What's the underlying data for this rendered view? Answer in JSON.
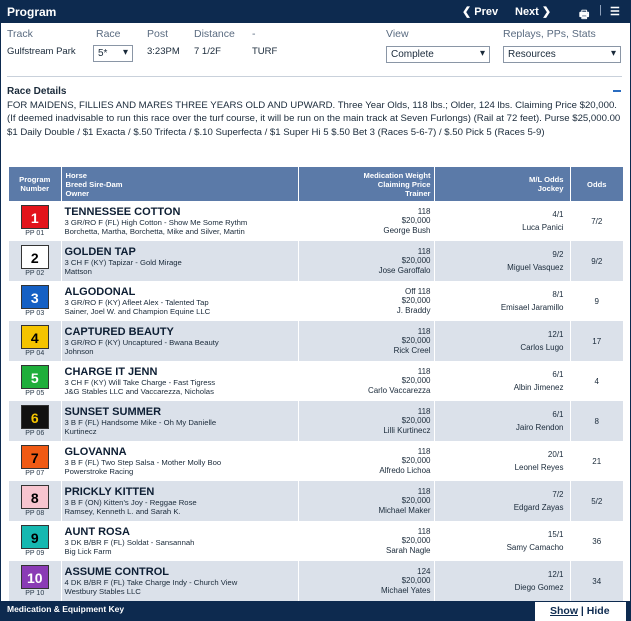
{
  "header": {
    "title": "Program",
    "prev_label": "❮ Prev",
    "next_label": "Next ❯",
    "print_glyph": "🖶",
    "separator": "|",
    "menu_glyph": "☰"
  },
  "fields": {
    "track_label": "Track",
    "track_value": "Gulfstream Park",
    "race_label": "Race",
    "race_value": "5*",
    "post_label": "Post",
    "post_value": "3:23PM",
    "distance_label": "Distance",
    "distance_value": "7 1/2F",
    "dash_label": "-",
    "surface_value": "TURF",
    "view_label": "View",
    "view_value": "Complete",
    "replays_label": "Replays, PPs, Stats",
    "replays_value": "Resources"
  },
  "race_details": {
    "title": "Race Details",
    "text": "FOR MAIDENS, FILLIES AND MARES THREE YEARS OLD AND UPWARD. Three Year Olds, 118 lbs.; Older, 124 lbs. Claiming Price $20,000. (If deemed inadvisable to run this race over the turf course, it will be run on the main track at Seven Furlongs) (Rail at 72 feet). Purse $25,000.00 $1 Daily Double / $1 Exacta / $.50 Trifecta / $.10 Superfecta / $1 Super Hi 5 $.50 Bet 3 (Races 5-6-7) / $.50 Pick 5 (Races 5-9)"
  },
  "table": {
    "headers": {
      "program": [
        "Program",
        "Number"
      ],
      "horse": [
        "Horse",
        "Breed Sire-Dam",
        "Owner"
      ],
      "medication": [
        "Medication Weight",
        "Claiming Price",
        "Trainer"
      ],
      "ml": [
        "M/L Odds",
        "Jockey"
      ],
      "odds": "Odds"
    },
    "rows": [
      {
        "num": "1",
        "pp": "PP 01",
        "bg": "#e3141b",
        "fg": "#ffffff",
        "horse": "TENNESSEE COTTON",
        "breed": "3 GR/RO F (FL) High Cotton - Show Me Some Rythm",
        "owner": "Borchetta, Martha, Borchetta, Mike and Silver, Martin",
        "med": "",
        "weight": "118",
        "claim": "$20,000",
        "trainer": "George Bush",
        "ml": "4/1",
        "jockey": "Luca Panici",
        "odds": "7/2"
      },
      {
        "num": "2",
        "pp": "PP 02",
        "bg": "#ffffff",
        "fg": "#000000",
        "horse": "GOLDEN TAP",
        "breed": "3 CH F (KY) Tapizar - Gold Mirage",
        "owner": "Mattson",
        "med": "",
        "weight": "118",
        "claim": "$20,000",
        "trainer": "Jose Garoffalo",
        "ml": "9/2",
        "jockey": "Miguel Vasquez",
        "odds": "9/2"
      },
      {
        "num": "3",
        "pp": "PP 03",
        "bg": "#1560c4",
        "fg": "#ffffff",
        "horse": "ALGODONAL",
        "breed": "3 GR/RO F (KY) Afleet Alex - Talented Tap",
        "owner": "Sainer, Joel W. and Champion Equine LLC",
        "med": "Off",
        "weight": "118",
        "claim": "$20,000",
        "trainer": "J. Braddy",
        "ml": "8/1",
        "jockey": "Emisael Jaramillo",
        "odds": "9"
      },
      {
        "num": "4",
        "pp": "PP 04",
        "bg": "#f5c400",
        "fg": "#000000",
        "horse": "CAPTURED BEAUTY",
        "breed": "3 GR/RO F (KY) Uncaptured - Bwana Beauty",
        "owner": "Johnson",
        "med": "",
        "weight": "118",
        "claim": "$20,000",
        "trainer": "Rick Creel",
        "ml": "12/1",
        "jockey": "Carlos Lugo",
        "odds": "17"
      },
      {
        "num": "5",
        "pp": "PP 05",
        "bg": "#1fae3b",
        "fg": "#ffffff",
        "horse": "CHARGE IT JENN",
        "breed": "3 CH F (KY) Will Take Charge - Fast Tigress",
        "owner": "J&G Stables LLC and Vaccarezza, Nicholas",
        "med": "",
        "weight": "118",
        "claim": "$20,000",
        "trainer": "Carlo Vaccarezza",
        "ml": "6/1",
        "jockey": "Albin Jimenez",
        "odds": "4"
      },
      {
        "num": "6",
        "pp": "PP 06",
        "bg": "#111111",
        "fg": "#f5c400",
        "horse": "SUNSET SUMMER",
        "breed": "3 B F (FL) Handsome Mike - Oh My Danielle",
        "owner": "Kurtinecz",
        "med": "",
        "weight": "118",
        "claim": "$20,000",
        "trainer": "Lilli Kurtinecz",
        "ml": "6/1",
        "jockey": "Jairo Rendon",
        "odds": "8"
      },
      {
        "num": "7",
        "pp": "PP 07",
        "bg": "#f05a14",
        "fg": "#000000",
        "horse": "GLOVANNA",
        "breed": "3 B F (FL) Two Step Salsa - Mother Molly Boo",
        "owner": "Powerstroke Racing",
        "med": "",
        "weight": "118",
        "claim": "$20,000",
        "trainer": "Alfredo Lichoa",
        "ml": "20/1",
        "jockey": "Leonel Reyes",
        "odds": "21"
      },
      {
        "num": "8",
        "pp": "PP 08",
        "bg": "#f7c5cf",
        "fg": "#000000",
        "horse": "PRICKLY KITTEN",
        "breed": "3 B F (ON) Kitten's Joy - Reggae Rose",
        "owner": "Ramsey, Kenneth L. and Sarah K.",
        "med": "",
        "weight": "118",
        "claim": "$20,000",
        "trainer": "Michael Maker",
        "ml": "7/2",
        "jockey": "Edgard Zayas",
        "odds": "5/2"
      },
      {
        "num": "9",
        "pp": "PP 09",
        "bg": "#16b8b0",
        "fg": "#000000",
        "horse": "AUNT ROSA",
        "breed": "3 DK B/BR F (FL) Soldat - Sansannah",
        "owner": "Big Lick Farm",
        "med": "",
        "weight": "118",
        "claim": "$20,000",
        "trainer": "Sarah Nagle",
        "ml": "15/1",
        "jockey": "Samy Camacho",
        "odds": "36"
      },
      {
        "num": "10",
        "pp": "PP 10",
        "bg": "#8a3bb5",
        "fg": "#ffffff",
        "horse": "ASSUME CONTROL",
        "breed": "4 DK B/BR F (FL) Take Charge Indy - Church View",
        "owner": "Westbury Stables LLC",
        "med": "",
        "weight": "124",
        "claim": "$20,000",
        "trainer": "Michael Yates",
        "ml": "12/1",
        "jockey": "Diego Gomez",
        "odds": "34"
      }
    ]
  },
  "footer": {
    "key_label": "Medication & Equipment Key",
    "show_label": "Show",
    "divider": " | ",
    "hide_label": "Hide"
  }
}
